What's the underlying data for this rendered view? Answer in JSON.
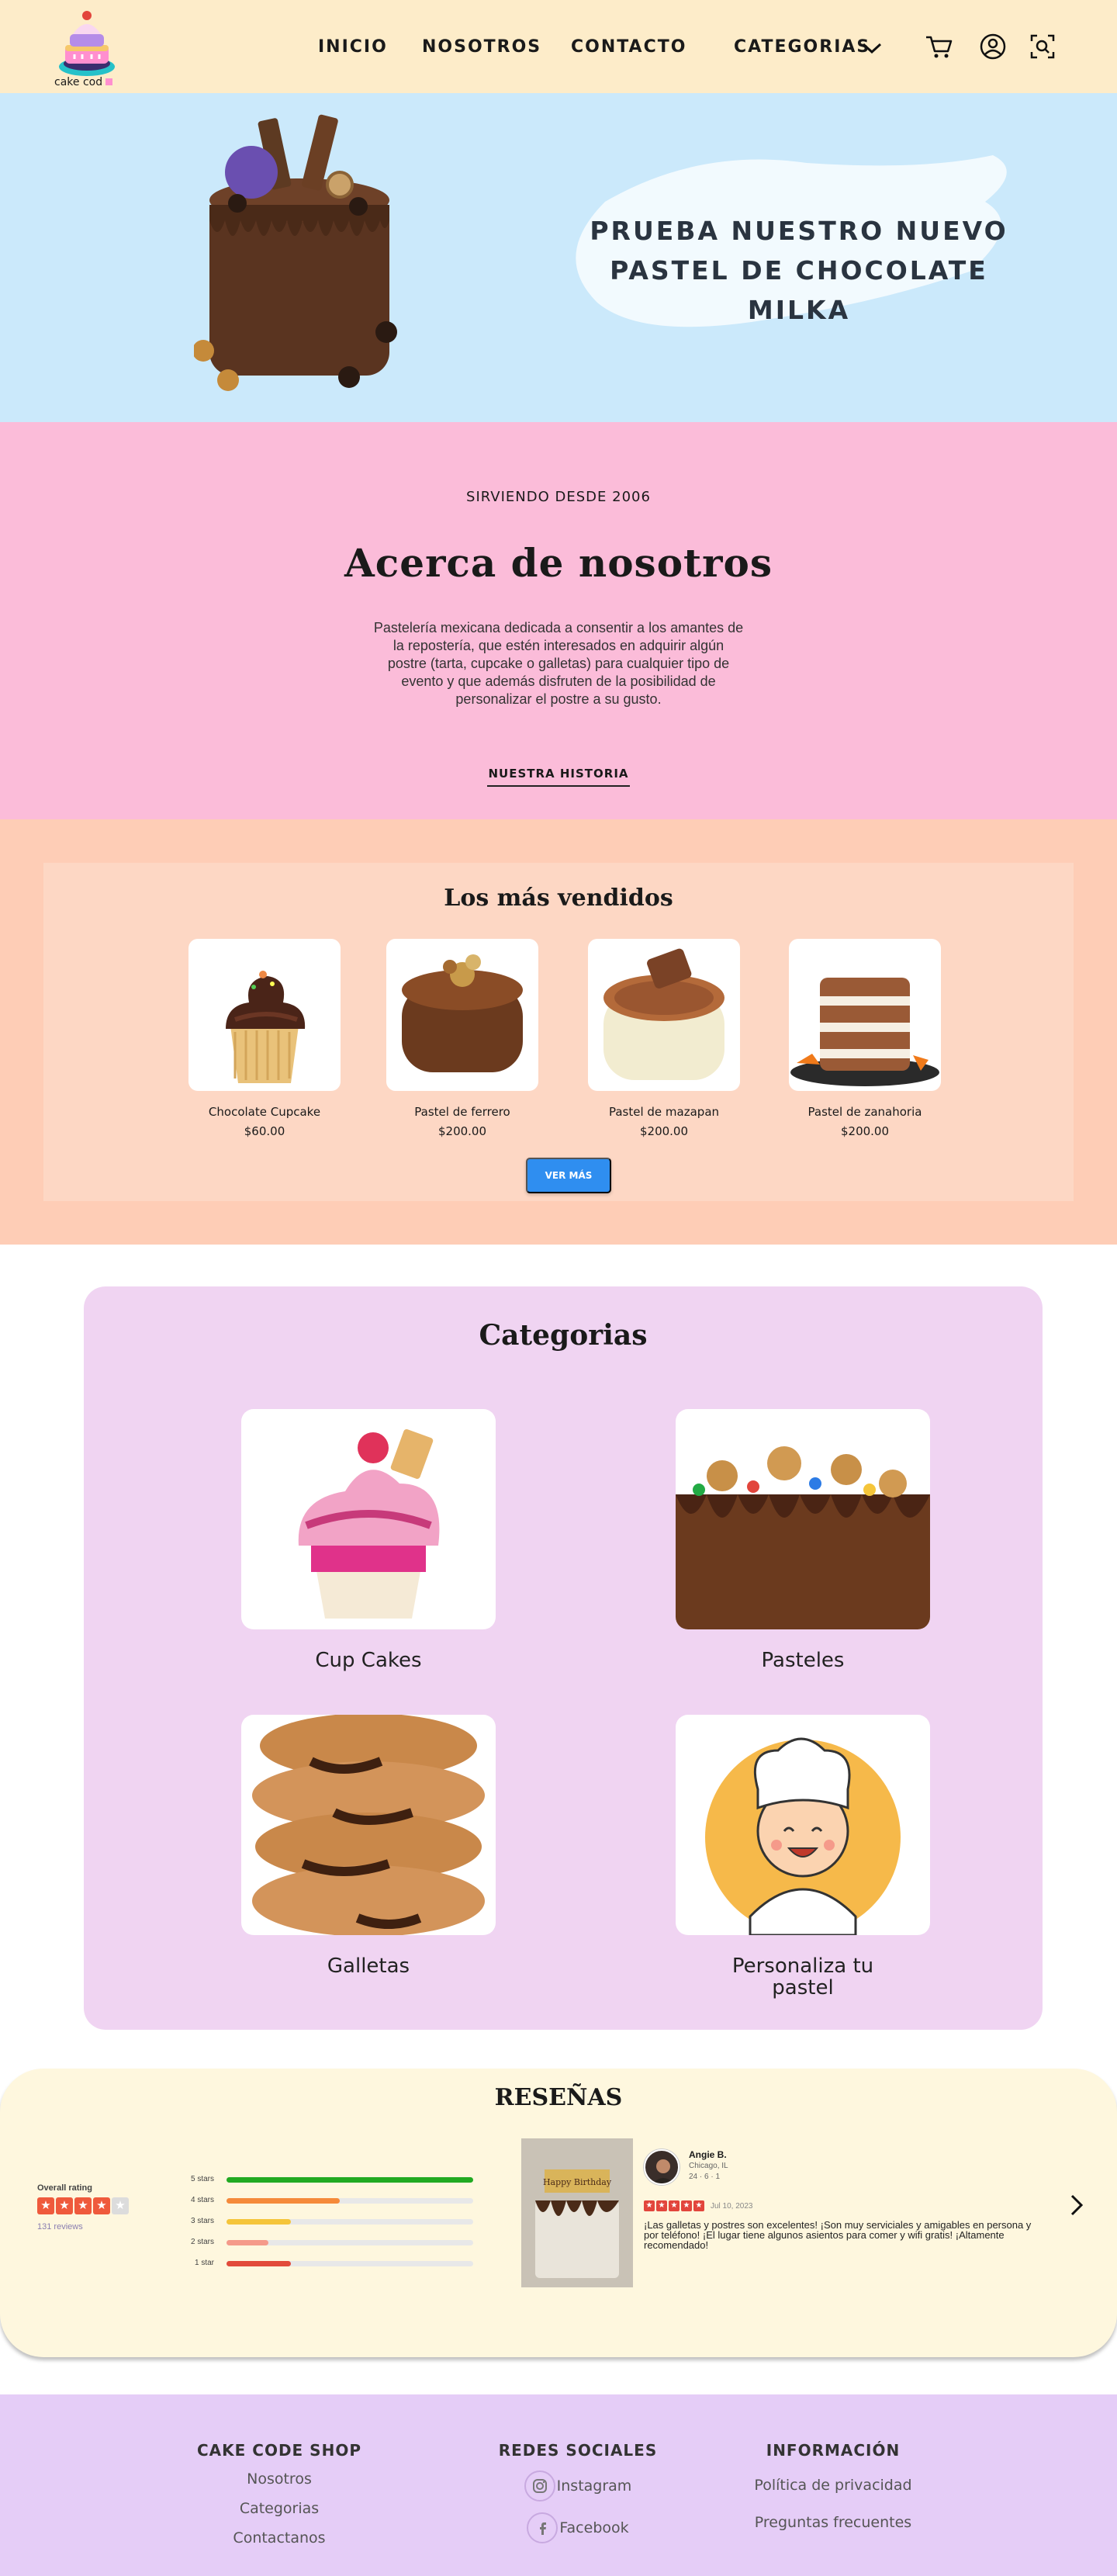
{
  "brand": {
    "logo_text": "cake cod"
  },
  "nav": {
    "links": [
      "INICIO",
      "NOSOTROS",
      "CONTACTO",
      "CATEGORIAS"
    ],
    "icons": [
      "cart-icon",
      "user-icon",
      "scan-search-icon"
    ]
  },
  "hero": {
    "title_line1": "PRUEBA NUESTRO NUEVO",
    "title_line2": "PASTEL DE CHOCOLATE MILKA"
  },
  "about": {
    "kicker": "SIRVIENDO DESDE 2006",
    "title": "Acerca de nosotros",
    "text": "Pastelería mexicana dedicada a consentir a los amantes de la repostería, que estén interesados en adquirir algún postre (tarta, cupcake o galletas) para cualquier tipo de evento y que además disfruten de la posibilidad de personalizar el postre a su gusto.",
    "link": "NUESTRA HISTORIA"
  },
  "best": {
    "title": "Los más vendidos",
    "products": [
      {
        "name": "Chocolate Cupcake",
        "price": "$60.00"
      },
      {
        "name": "Pastel de ferrero",
        "price": "$200.00"
      },
      {
        "name": "Pastel de mazapan",
        "price": "$200.00"
      },
      {
        "name": "Pastel de zanahoria",
        "price": "$200.00"
      }
    ],
    "button": "VER MÁS"
  },
  "categories": {
    "title": "Categorias",
    "items": [
      "Cup Cakes",
      "Pasteles",
      "Galletas",
      "Personaliza tu pastel"
    ]
  },
  "reviews": {
    "title": "RESEÑAS",
    "overall_label": "Overall rating",
    "overall_rating": 4,
    "count_text": "131 reviews",
    "bars": [
      {
        "label": "5 stars",
        "fraction": 1.0,
        "color": "#22aa22"
      },
      {
        "label": "4 stars",
        "fraction": 0.46,
        "color": "#f58a3a"
      },
      {
        "label": "3 stars",
        "fraction": 0.26,
        "color": "#f5c53a"
      },
      {
        "label": "2 stars",
        "fraction": 0.17,
        "color": "#f59a8a"
      },
      {
        "label": "1 star",
        "fraction": 0.26,
        "color": "#e24b3a"
      }
    ],
    "review": {
      "name": "Angie B.",
      "location": "Chicago, IL",
      "meta": "24 · 6 · 1",
      "stars": 5,
      "date": "Jul 10, 2023",
      "text": "¡Las galletas y postres son excelentes! ¡Son muy serviciales y amigables en persona y por teléfono! ¡El lugar tiene algunos asientos para comer y wifi gratis! ¡Altamente recomendado!",
      "photo_text": "Happy Birthday"
    }
  },
  "footer": {
    "col1": {
      "title": "CAKE CODE SHOP",
      "links": [
        "Nosotros",
        "Categorias",
        "Contactanos"
      ]
    },
    "col2": {
      "title": "REDES SOCIALES",
      "links": [
        "Instagram",
        "Facebook"
      ]
    },
    "col3": {
      "title": "INFORMACIÓN",
      "links": [
        "Política de privacidad",
        "Preguntas frecuentes"
      ]
    }
  },
  "colors": {
    "nav_bg": "#fdecc9",
    "hero_bg": "#cbe9fb",
    "about_bg": "#fbbcd9",
    "best_bg": "#fecdb6",
    "categories_bg": "#f0d4f2",
    "reviews_bg": "#fef7de",
    "footer_bg": "#e5cdf7",
    "button": "#2f8ef0"
  }
}
